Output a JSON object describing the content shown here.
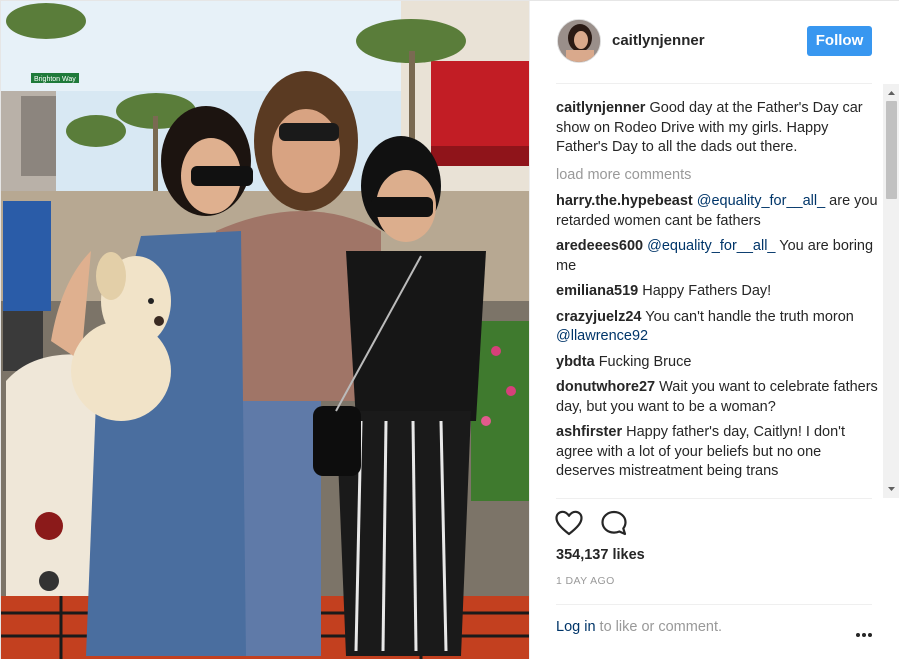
{
  "post": {
    "username": "caitlynjenner",
    "follow_label": "Follow",
    "caption_user": "caitlynjenner",
    "caption_text": "Good day at the Father's Day car show on Rodeo Drive with my girls. Happy Father's Day to all the dads out there.",
    "load_more": "load more comments",
    "likes": "354,137 likes",
    "timestamp": "1 DAY AGO",
    "login_link": "Log in",
    "login_suffix": " to like or comment."
  },
  "photo": {
    "street_sign": "Brighton Way"
  },
  "comments": [
    {
      "user": "harry.the.hypebeast",
      "mention": "@equality_for__all_",
      "text": " are you retarded women cant be fathers"
    },
    {
      "user": "aredeees600",
      "mention": "@equality_for__all_",
      "text": " You are boring me"
    },
    {
      "user": "emiliana519",
      "mention": "",
      "text": "Happy Fathers Day!"
    },
    {
      "user": "crazyjuelz24",
      "text": "You can't handle the truth moron ",
      "mention_after": "@llawrence92"
    },
    {
      "user": "ybdta",
      "mention": "",
      "text": "Fucking Bruce"
    },
    {
      "user": "donutwhore27",
      "mention": "",
      "text": "Wait you want to celebrate fathers day, but you want to be a woman?"
    },
    {
      "user": "ashfirster",
      "mention": "",
      "text": "Happy father's day, Caitlyn! I don't agree with a lot of your beliefs but no one deserves mistreatment being trans"
    }
  ],
  "icons": {
    "like": "heart-icon",
    "comment": "comment-icon",
    "more": "more-options-icon"
  },
  "colors": {
    "follow_button": "#3897f0",
    "mention": "#003569",
    "muted": "#999999"
  }
}
